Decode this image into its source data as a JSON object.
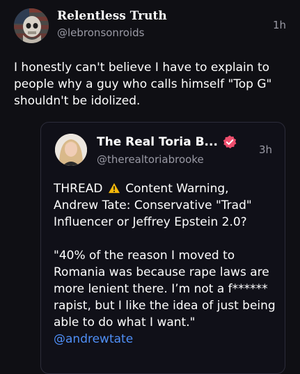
{
  "post": {
    "author": {
      "display_name": "Relentless Truth",
      "handle": "@lebronsonroids",
      "avatar_icon": "flag-skull-avatar"
    },
    "time": "1h",
    "text": "I honestly can't believe I have to explain to people why a guy who calls himself \"Top G\" shouldn't be idolized."
  },
  "quote": {
    "author": {
      "display_name": "The Real Toria B...",
      "handle": "@therealtoriabrooke",
      "avatar_icon": "portrait-avatar",
      "verified_icon": "verified-badge-icon",
      "verified_color": "#ee4e6d"
    },
    "time": "3h",
    "thread_label": "THREAD",
    "warning_icon": "warning-triangle-icon",
    "warning_rest": "Content Warning, Andrew Tate: Conservative \"Trad\" Influencer or Jeffrey Epstein 2.0?",
    "paragraph2": "\"40% of the reason I moved to Romania was because rape laws are more lenient there. I’m not a f****** rapist, but I like the idea of just being able to do what I want.\"",
    "mention": "@andrewtate",
    "mention_color": "#4f8ff7"
  }
}
